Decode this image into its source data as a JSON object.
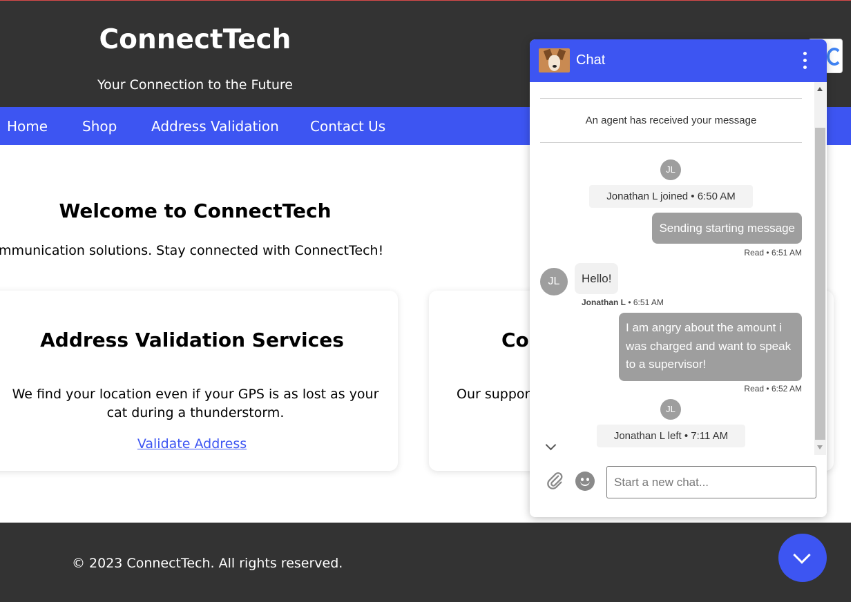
{
  "site": {
    "title": "ConnectTech",
    "tagline": "Your Connection to the Future"
  },
  "nav": {
    "items": [
      {
        "label": "Home"
      },
      {
        "label": "Shop"
      },
      {
        "label": "Address Validation"
      },
      {
        "label": "Contact Us"
      }
    ]
  },
  "welcome": {
    "title": "Welcome to ConnectTech",
    "text": "er for cutting-edge telecommunication solutions. Stay connected with ConnectTech!"
  },
  "cards": [
    {
      "title": "Address Validation Services",
      "text": "We find your location even if your GPS is as lost as your cat during a thunderstorm.",
      "link": "Validate Address"
    },
    {
      "title": "Co",
      "text": "Our support"
    }
  ],
  "footer": {
    "text": "© 2023 ConnectTech. All rights reserved."
  },
  "chat": {
    "title": "Chat",
    "system_note": "An agent has received your message",
    "events": [
      {
        "avatar": "JL",
        "text": "Jonathan L joined • 6:50 AM"
      },
      {
        "avatar": "JL",
        "text": "Jonathan L left • 7:11 AM"
      }
    ],
    "messages": [
      {
        "direction": "out",
        "text": "Sending starting message",
        "meta": "Read • 6:51 AM"
      },
      {
        "direction": "in",
        "avatar": "JL",
        "text": "Hello!",
        "sender": "Jonathan L",
        "time": " • 6:51 AM"
      },
      {
        "direction": "out",
        "text": "I am angry about the amount i was charged and want to speak to a supervisor!",
        "meta": "Read • 6:52 AM"
      }
    ],
    "input_placeholder": "Start a new chat..."
  },
  "colors": {
    "accent": "#3d55f2",
    "header_bg": "#333333",
    "bubble_out": "#9e9e9e"
  },
  "icons": [
    "menu-dots-icon",
    "chevron-down-icon",
    "attach-icon",
    "emoji-icon",
    "language-icon"
  ]
}
